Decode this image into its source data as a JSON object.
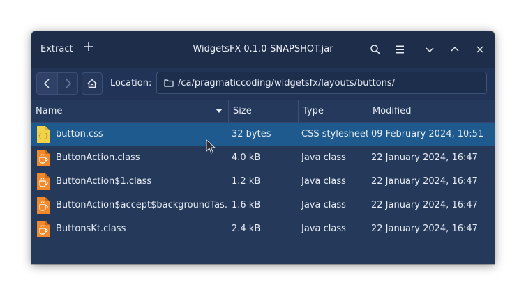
{
  "window": {
    "title": "WidgetsFX-0.1.0-SNAPSHOT.jar",
    "extract_label": "Extract"
  },
  "titlebar_icons": {
    "add": "plus-icon",
    "search": "search-icon",
    "menu": "hamburger-menu-icon",
    "minimize": "chevron-down-icon",
    "maximize": "chevron-up-icon",
    "close": "close-icon"
  },
  "toolbar": {
    "location_label": "Location:",
    "location_path": "/ca/pragmaticcoding/widgetsfx/layouts/buttons/"
  },
  "columns": {
    "name": "Name",
    "size": "Size",
    "type": "Type",
    "modified": "Modified"
  },
  "files": [
    {
      "name": "button.css",
      "size": "32 bytes",
      "type": "CSS stylesheet",
      "modified": "09 February 2024, 10:51",
      "icon": "css-file-icon",
      "selected": true
    },
    {
      "name": "ButtonAction.class",
      "size": "4.0 kB",
      "type": "Java class",
      "modified": "22 January 2024, 16:47",
      "icon": "java-class-icon",
      "selected": false
    },
    {
      "name": "ButtonAction$1.class",
      "size": "1.2 kB",
      "type": "Java class",
      "modified": "22 January 2024, 16:47",
      "icon": "java-class-icon",
      "selected": false
    },
    {
      "name": "ButtonAction$accept$backgroundTas...",
      "size": "1.6 kB",
      "type": "Java class",
      "modified": "22 January 2024, 16:47",
      "icon": "java-class-icon",
      "selected": false
    },
    {
      "name": "ButtonsKt.class",
      "size": "2.4 kB",
      "type": "Java class",
      "modified": "22 January 2024, 16:47",
      "icon": "java-class-icon",
      "selected": false
    }
  ],
  "colors": {
    "window_bg": "#25395a",
    "titlebar_bg": "#1d2d4a",
    "selection": "#1f5a8f",
    "css_icon": "#f2d24b",
    "java_icon": "#f08a2c"
  }
}
